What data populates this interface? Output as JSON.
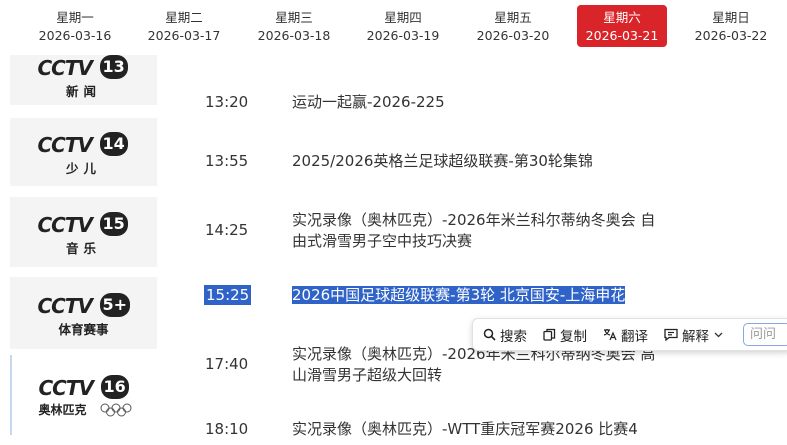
{
  "date_tabs": [
    {
      "weekday": "星期一",
      "date": "2026-03-16",
      "active": false
    },
    {
      "weekday": "星期二",
      "date": "2026-03-17",
      "active": false
    },
    {
      "weekday": "星期三",
      "date": "2026-03-18",
      "active": false
    },
    {
      "weekday": "星期四",
      "date": "2026-03-19",
      "active": false
    },
    {
      "weekday": "星期五",
      "date": "2026-03-20",
      "active": false
    },
    {
      "weekday": "星期六",
      "date": "2026-03-21",
      "active": true
    },
    {
      "weekday": "星期日",
      "date": "2026-03-22",
      "active": false
    }
  ],
  "colors": {
    "active_tab": "#d9252a",
    "selection": "#2f63c7"
  },
  "channels": [
    {
      "brand": "CCTV",
      "number": "13",
      "name": "新闻",
      "icon": "cctv13-logo"
    },
    {
      "brand": "CCTV",
      "number": "14",
      "name": "少儿",
      "icon": "cctv14-logo"
    },
    {
      "brand": "CCTV",
      "number": "15",
      "name": "音乐",
      "icon": "cctv15-logo"
    },
    {
      "brand": "CCTV",
      "number": "5+",
      "name": "体育赛事",
      "icon": "cctv5plus-logo"
    },
    {
      "brand": "CCTV",
      "number": "16",
      "name": "奥林匹克",
      "icon": "cctv16-logo"
    }
  ],
  "programs": [
    {
      "time": "13:20",
      "title_lines": [
        "运动一起赢-2026-225"
      ]
    },
    {
      "time": "13:55",
      "title_lines": [
        "2025/2026英格兰足球超级联赛-第30轮集锦"
      ]
    },
    {
      "time": "14:25",
      "title_lines": [
        "实况录像（奥林匹克）-2026年米兰科尔蒂纳冬奥会 自",
        "由式滑雪男子空中技巧决赛"
      ]
    },
    {
      "time": "15:25",
      "title_lines": [
        "2026中国足球超级联赛-第3轮 北京国安-上海申花"
      ]
    },
    {
      "time": "17:40",
      "title_lines": [
        "实况录像（奥林匹克）-2026年米兰科尔蒂纳冬奥会 高",
        "山滑雪男子超级大回转"
      ]
    },
    {
      "time": "18:10",
      "title_lines": [
        "实况录像（奥林匹克）-WTT重庆冠军赛2026 比赛4"
      ]
    }
  ],
  "toolbar": {
    "search": "搜索",
    "copy": "复制",
    "translate": "翻译",
    "explain": "解释",
    "ask_placeholder": "问问"
  }
}
